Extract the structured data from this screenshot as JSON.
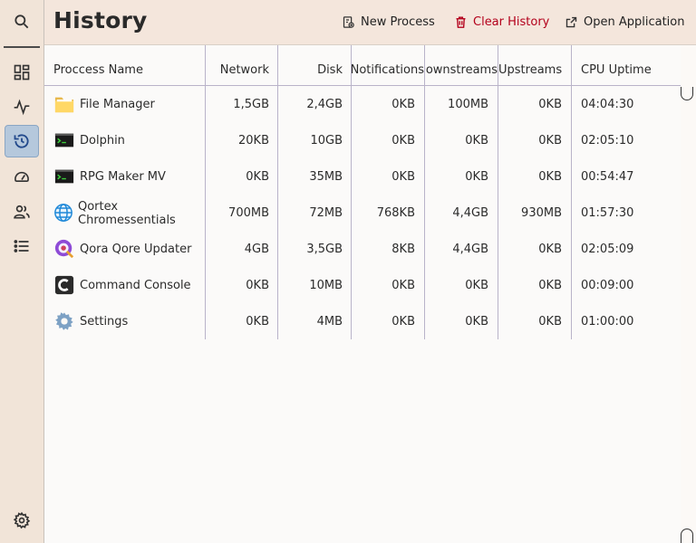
{
  "sidebar": {
    "items": [
      {
        "name": "search-icon"
      },
      {
        "name": "dashboard-icon"
      },
      {
        "name": "activity-icon"
      },
      {
        "name": "history-icon",
        "active": true
      },
      {
        "name": "gauge-icon"
      },
      {
        "name": "users-icon"
      },
      {
        "name": "list-icon"
      },
      {
        "name": "gear-icon"
      }
    ]
  },
  "header": {
    "title": "History",
    "new_process": "New Process",
    "clear_history": "Clear History",
    "open_application": "Open Application"
  },
  "table": {
    "columns": [
      "Proccess Name",
      "Network",
      "Disk",
      "Notifications",
      "Downstreams",
      "Upstreams",
      "CPU Uptime"
    ],
    "rows": [
      {
        "icon": "folder-icon",
        "name": "File Manager",
        "network": "1,5GB",
        "disk": "2,4GB",
        "notifications": "0KB",
        "downstreams": "100MB",
        "upstreams": "0KB",
        "uptime": "04:04:30"
      },
      {
        "icon": "terminal-icon",
        "name": "Dolphin",
        "network": "20KB",
        "disk": "10GB",
        "notifications": "0KB",
        "downstreams": "0KB",
        "upstreams": "0KB",
        "uptime": "02:05:10"
      },
      {
        "icon": "terminal-icon",
        "name": "RPG Maker MV",
        "network": "0KB",
        "disk": "35MB",
        "notifications": "0KB",
        "downstreams": "0KB",
        "upstreams": "0KB",
        "uptime": "00:54:47"
      },
      {
        "icon": "globe-icon",
        "name_line1": "Qortex",
        "name_line2": "Chromessentials",
        "network": "700MB",
        "disk": "72MB",
        "notifications": "768KB",
        "downstreams": "4,4GB",
        "upstreams": "930MB",
        "uptime": "01:57:30"
      },
      {
        "icon": "updater-icon",
        "name": "Qora Qore Updater",
        "network": "4GB",
        "disk": "3,5GB",
        "notifications": "8KB",
        "downstreams": "4,4GB",
        "upstreams": "0KB",
        "uptime": "02:05:09"
      },
      {
        "icon": "console-icon",
        "name": "Command Console",
        "network": "0KB",
        "disk": "10MB",
        "notifications": "0KB",
        "downstreams": "0KB",
        "upstreams": "0KB",
        "uptime": "00:09:00"
      },
      {
        "icon": "settings-icon",
        "name": "Settings",
        "network": "0KB",
        "disk": "4MB",
        "notifications": "0KB",
        "downstreams": "0KB",
        "upstreams": "0KB",
        "uptime": "01:00:00"
      }
    ]
  },
  "colors": {
    "sidebar_bg": "#f1e4d8",
    "active_bg": "#b5c8dc",
    "danger": "#b3001b",
    "grid": "#b9b3c9"
  }
}
